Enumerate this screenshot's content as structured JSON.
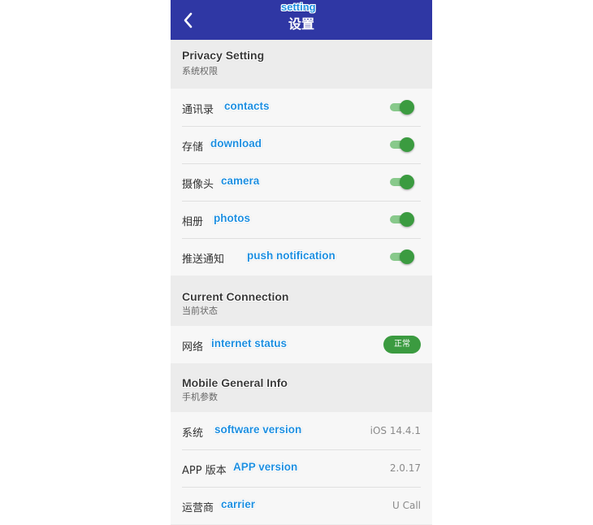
{
  "header": {
    "title": "设置",
    "annotation": "setting"
  },
  "privacy": {
    "title_en": "Privacy Setting",
    "title_cn": "系统权限",
    "items": [
      {
        "label": "通讯录",
        "annotation": "contacts",
        "enabled": true
      },
      {
        "label": "存储",
        "annotation": "download",
        "enabled": true
      },
      {
        "label": "摄像头",
        "annotation": "camera",
        "enabled": true
      },
      {
        "label": "相册",
        "annotation": "photos",
        "enabled": true
      },
      {
        "label": "推送通知",
        "annotation": "push notification",
        "enabled": true
      }
    ]
  },
  "connection": {
    "title_en": "Current Connection",
    "title_cn": "当前状态",
    "item": {
      "label": "网络",
      "annotation": "internet status",
      "status": "正常"
    }
  },
  "mobile": {
    "title_en": "Mobile General Info",
    "title_cn": "手机参数",
    "items": [
      {
        "label": "系统",
        "annotation": "software version",
        "value": "iOS 14.4.1"
      },
      {
        "label": "APP 版本",
        "annotation": "APP version",
        "value": "2.0.17"
      },
      {
        "label": "运营商",
        "annotation": "carrier",
        "value": "U Call"
      }
    ]
  },
  "colors": {
    "header_bg": "#2f37a4",
    "toggle_on": "#3b9b40",
    "annotation": "#1e8fe0",
    "page_bg": "#ececec"
  }
}
